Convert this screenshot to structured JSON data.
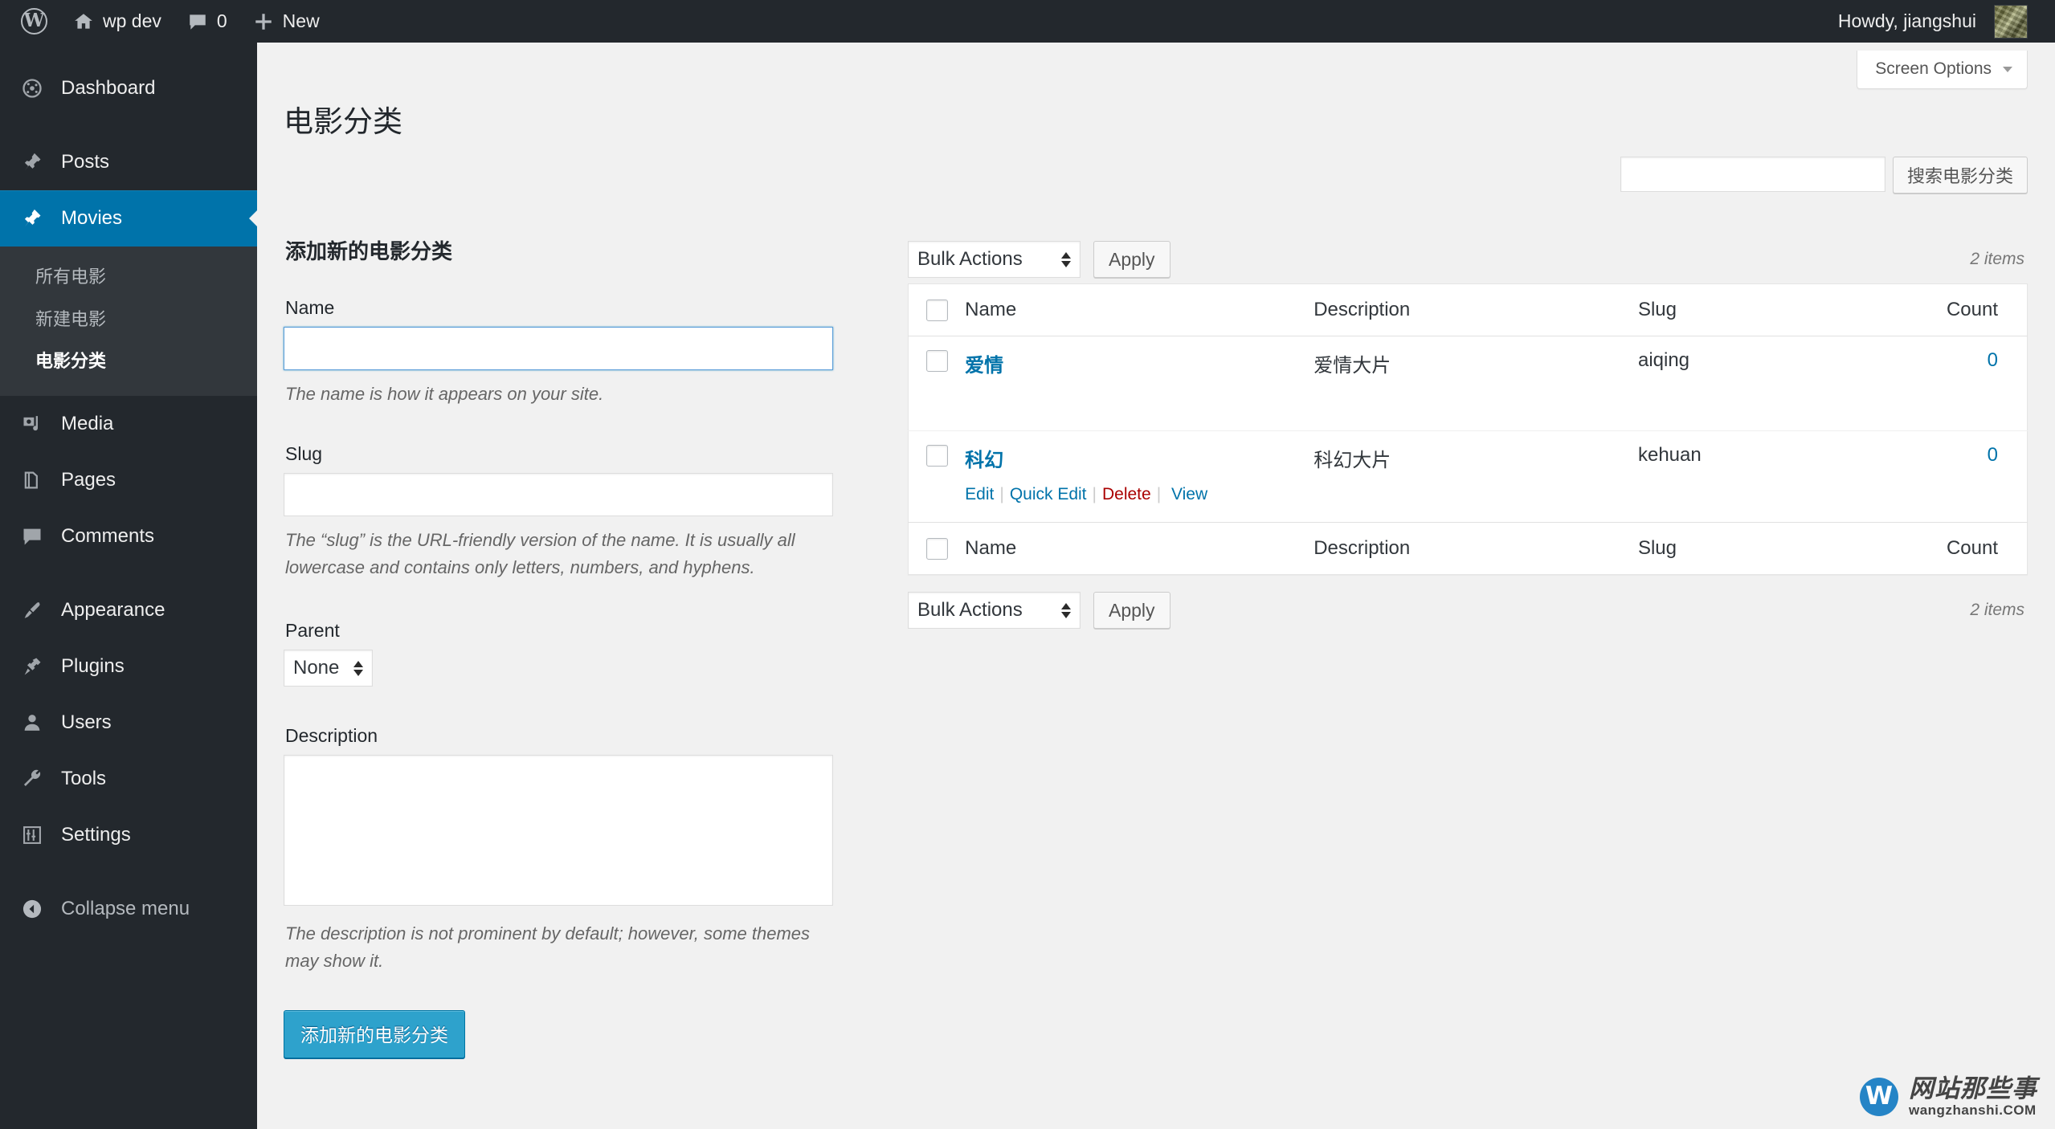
{
  "adminbar": {
    "wp_logo": "wordpress-logo",
    "site_name": "wp dev",
    "comments_count": "0",
    "new_label": "New",
    "howdy": "Howdy, jiangshui"
  },
  "sidebar": {
    "items": [
      {
        "label": "Dashboard",
        "icon": "dashboard-icon",
        "current": false
      },
      {
        "label": "Posts",
        "icon": "pin-icon",
        "current": false
      },
      {
        "label": "Movies",
        "icon": "pin-icon",
        "current": true
      },
      {
        "label": "Media",
        "icon": "media-icon",
        "current": false
      },
      {
        "label": "Pages",
        "icon": "pages-icon",
        "current": false
      },
      {
        "label": "Comments",
        "icon": "comment-icon",
        "current": false
      },
      {
        "label": "Appearance",
        "icon": "brush-icon",
        "current": false
      },
      {
        "label": "Plugins",
        "icon": "plug-icon",
        "current": false
      },
      {
        "label": "Users",
        "icon": "user-icon",
        "current": false
      },
      {
        "label": "Tools",
        "icon": "wrench-icon",
        "current": false
      },
      {
        "label": "Settings",
        "icon": "settings-icon",
        "current": false
      }
    ],
    "submenu": [
      {
        "label": "所有电影",
        "current": false
      },
      {
        "label": "新建电影",
        "current": false
      },
      {
        "label": "电影分类",
        "current": true
      }
    ],
    "collapse_label": "Collapse menu"
  },
  "screen_meta": {
    "screen_options_label": "Screen Options"
  },
  "page": {
    "title": "电影分类"
  },
  "search": {
    "value": "",
    "placeholder": "",
    "button_label": "搜索电影分类"
  },
  "form": {
    "heading": "添加新的电影分类",
    "name": {
      "label": "Name",
      "value": "",
      "description": "The name is how it appears on your site."
    },
    "slug": {
      "label": "Slug",
      "value": "",
      "description": "The “slug” is the URL-friendly version of the name. It is usually all lowercase and contains only letters, numbers, and hyphens."
    },
    "parent": {
      "label": "Parent",
      "selected": "None"
    },
    "description": {
      "label": "Description",
      "value": "",
      "help": "The description is not prominent by default; however, some themes may show it."
    },
    "submit_label": "添加新的电影分类"
  },
  "tablenav": {
    "bulk_actions_label": "Bulk Actions",
    "apply_label": "Apply",
    "items_count_top": "2 items",
    "items_count_bottom": "2 items"
  },
  "table": {
    "columns": [
      "Name",
      "Description",
      "Slug",
      "Count"
    ],
    "rows": [
      {
        "name": "爱情",
        "description": "爱情大片",
        "slug": "aiqing",
        "count": "0",
        "actions": []
      },
      {
        "name": "科幻",
        "description": "科幻大片",
        "slug": "kehuan",
        "count": "0",
        "actions": [
          "Edit",
          "Quick Edit",
          "Delete",
          "View"
        ]
      }
    ]
  },
  "watermark": {
    "mark": "W",
    "cn": "网站那些事",
    "en": "wangzhanshi.COM"
  },
  "colors": {
    "adminbar_bg": "#23282d",
    "sidebar_bg": "#23282d",
    "current_blue": "#0073aa",
    "link_blue": "#0073aa",
    "delete_red": "#a00",
    "primary_button": "#2ea2cc",
    "page_bg": "#f1f1f1"
  }
}
